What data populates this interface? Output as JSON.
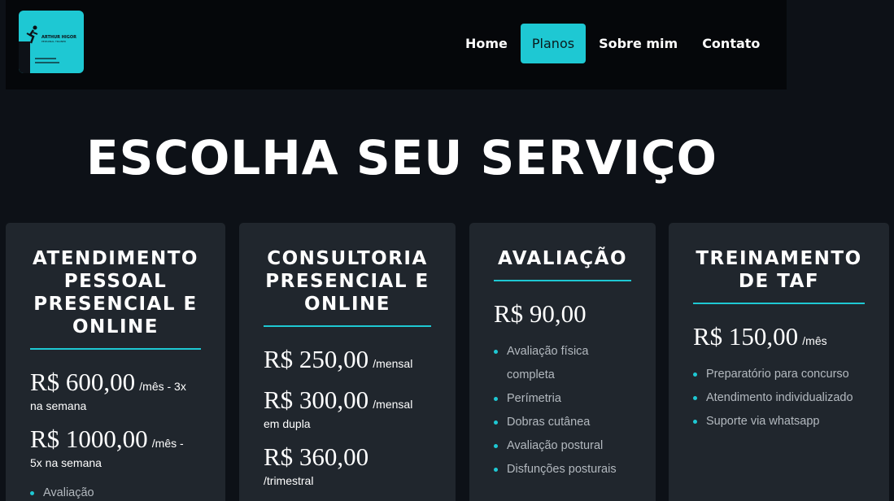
{
  "logo": {
    "brand": "ARTHUR HIGOR",
    "subtitle": "PERSONAL TRAINER"
  },
  "nav": {
    "items": [
      "Home",
      "Planos",
      "Sobre mim",
      "Contato"
    ],
    "active": "Planos"
  },
  "page_title": "ESCOLHA SEU SERVIÇO",
  "cards": [
    {
      "title": "ATENDIMENTO PESSOAL PRESENCIAL E ONLINE",
      "prices": [
        {
          "price": "R$ 600,00",
          "unit": "/mês - 3x",
          "unit_line": "na semana"
        },
        {
          "price": "R$ 1000,00",
          "unit": "/mês -",
          "unit_line": "5x na semana"
        }
      ],
      "features": [
        "Avaliação"
      ]
    },
    {
      "title": "CONSULTORIA PRESENCIAL E ONLINE",
      "prices": [
        {
          "price": "R$ 250,00",
          "unit": "/mensal",
          "unit_line": ""
        },
        {
          "price": "R$ 300,00",
          "unit": "/mensal",
          "unit_line": "em dupla"
        },
        {
          "price": "R$ 360,00",
          "unit": "",
          "unit_line": "/trimestral"
        }
      ],
      "features": []
    },
    {
      "title": "AVALIAÇÃO",
      "prices": [
        {
          "price": "R$ 90,00",
          "unit": "",
          "unit_line": ""
        }
      ],
      "features": [
        "Avaliação física completa",
        "Perímetria",
        "Dobras cutânea",
        "Avaliação postural",
        "Disfunções posturais"
      ]
    },
    {
      "title": "TREINAMENTO DE TAF",
      "prices": [
        {
          "price": "R$ 150,00",
          "unit": "/mês",
          "unit_line": ""
        }
      ],
      "features": [
        "Preparatório para concurso",
        "Atendimento individualizado",
        "Suporte via whatsapp"
      ]
    }
  ],
  "colors": {
    "accent": "#1ec8d3",
    "background": "#0d1117",
    "card": "#20262d",
    "header": "#05070a"
  }
}
